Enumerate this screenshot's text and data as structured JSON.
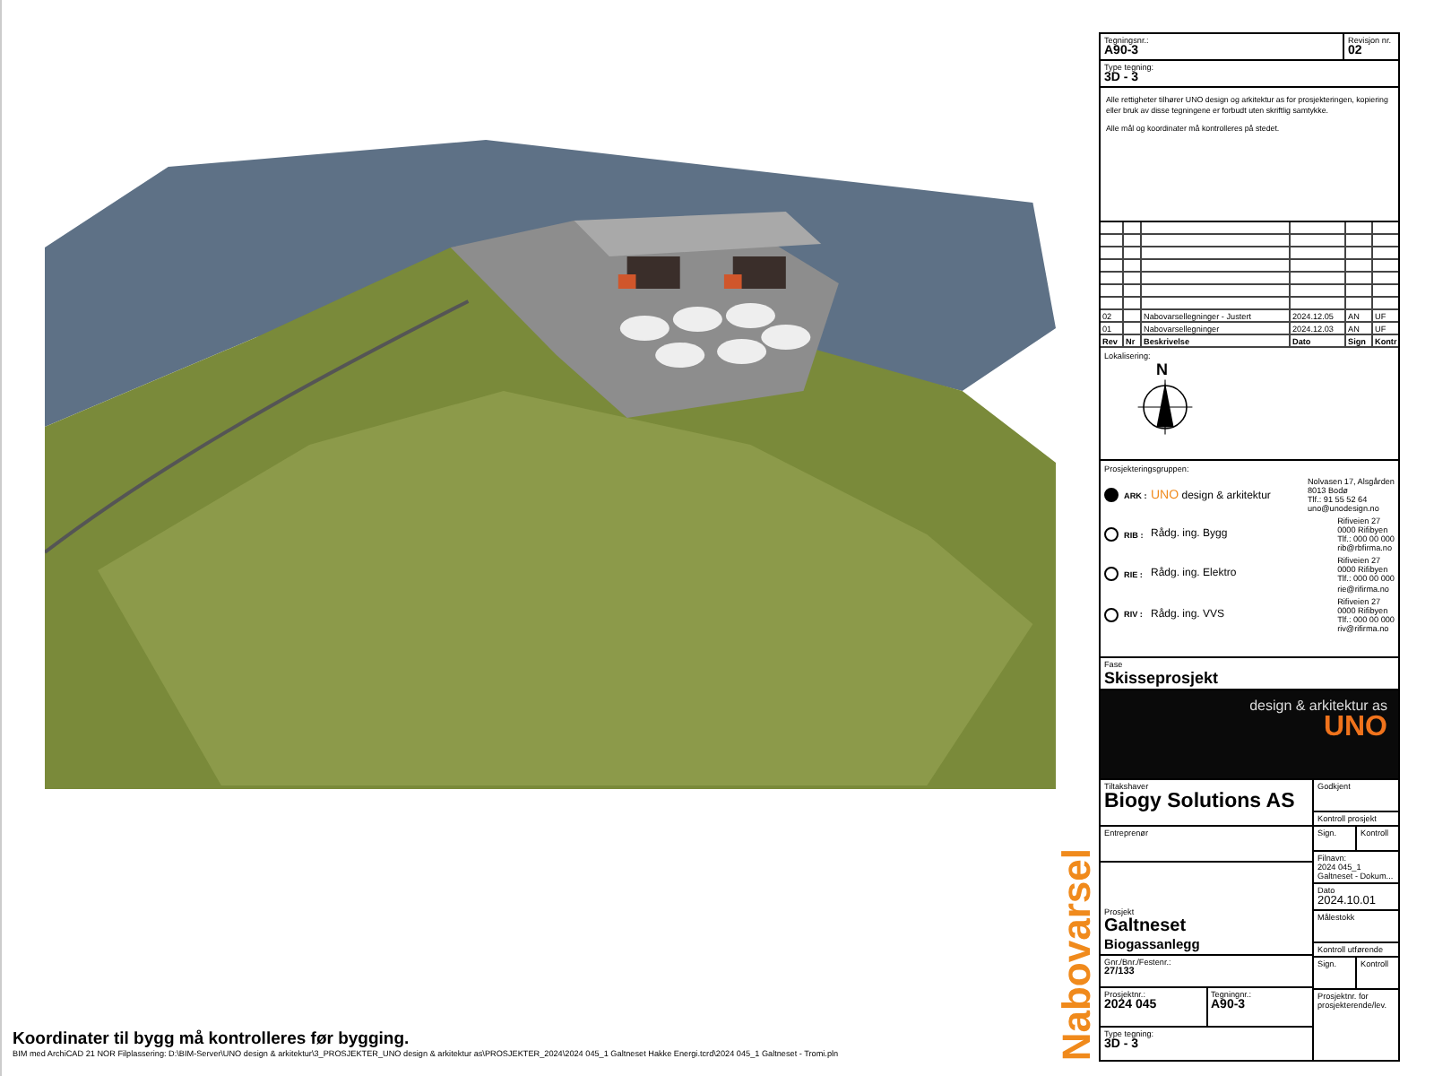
{
  "drawing": {
    "note": "Koordinater til bygg må kontrolleres før bygging.",
    "file_path": "BIM med ArchiCAD 21 NOR    Filplassering: D:\\BIM-Server\\UNO design & arkitektur\\3_PROSJEKTER_UNO design & arkitektur as\\PROSJEKTER_2024\\2024 045_1 Galtneset Hakke Energi.tcrd\\2024 045_1 Galtneset - Tromi.pln",
    "stamp": "Nabovarsel"
  },
  "title_block": {
    "top": [
      {
        "label": "Tegningsnr.:",
        "value": "A90-3"
      },
      {
        "label": "Revisjon nr.",
        "value": "02"
      }
    ],
    "type": {
      "label": "Type tegning:",
      "value": "3D - 3"
    },
    "notes": [
      "Alle rettigheter tilhører UNO design og arkitektur as for prosjekteringen, kopiering eller bruk av disse tegningene er forbudt uten skriftlig samtykke.",
      "Alle mål og koordinater må kontrolleres på stedet."
    ],
    "revisions": {
      "rows": [
        {
          "rev": "02",
          "description": "Nabovarsellegninger - Justert",
          "date": "2024.12.05",
          "sign": "AN",
          "control": "UF"
        },
        {
          "rev": "01",
          "description": "Nabovarsellegninger",
          "date": "2024.12.03",
          "sign": "AN",
          "control": "UF"
        }
      ],
      "columns": [
        "Rev",
        "Nr",
        "Beskrivelse",
        "Dato",
        "Sign",
        "Kontr"
      ]
    },
    "location": {
      "label": "Lokalisering:",
      "north": "N"
    },
    "team": {
      "label": "Prosjekteringsgruppen:",
      "members": [
        {
          "role": "ARK :",
          "brand": "UNO",
          "name": " design & arkitektur",
          "selected": true,
          "address": [
            "Nolvasen 17, Alsgården",
            "8013 Bodø",
            "Tlf.: 91 55 52 64",
            "uno@unodesign.no"
          ]
        },
        {
          "role": "RIB :",
          "name": "Rådg. ing. Bygg",
          "selected": false,
          "address": [
            "Rifiveien 27",
            "0000 Rifibyen",
            "Tlf.: 000 00 000",
            "rib@rbfirma.no"
          ]
        },
        {
          "role": "RIE :",
          "name": "Rådg. ing. Elektro",
          "selected": false,
          "address": [
            "Rifiveien 27",
            "0000 Rifibyen",
            "Tlf.: 000 00 000",
            "rie@rifirma.no"
          ]
        },
        {
          "role": "RIV :",
          "name": "Rådg. ing. VVS",
          "selected": false,
          "address": [
            "Rifiveien 27",
            "0000 Rifibyen",
            "Tlf.: 000 00 000",
            "riv@rifirma.no"
          ]
        }
      ]
    },
    "phase": {
      "label": "Fase",
      "value": "Skisseprosjekt"
    },
    "logo": {
      "tagline": "design & arkitektur as",
      "name": "UNO"
    },
    "client": {
      "label": "Tiltakshaver",
      "value": "Biogy Solutions AS"
    },
    "contractor": {
      "label": "Entreprenør"
    },
    "project": {
      "label": "Prosjekt",
      "name": "Galtneset",
      "subtitle": "Biogassanlegg"
    },
    "property": {
      "label": "Gnr./Bnr./Festenr.:",
      "value": "27/133"
    },
    "project_no": {
      "label": "Prosjektnr.:",
      "value": "2024 045"
    },
    "drawing_no": {
      "label": "Tegningnr.:",
      "value": "A90-3"
    },
    "drawing_type": {
      "label": "Type tegning:",
      "value": "3D - 3"
    },
    "approved": {
      "label": "Godkjent"
    },
    "check_project": {
      "label": "Kontroll prosjekt",
      "sign": "Sign.",
      "control": "Kontroll"
    },
    "file_name": {
      "label": "Filnavn:",
      "value": "2024 045_1 Galtneset - Dokum..."
    },
    "date": {
      "label": "Dato",
      "value": "2024.10.01"
    },
    "scale": {
      "label": "Målestokk"
    },
    "check_exec": {
      "label": "Kontroll utførende",
      "sign": "Sign.",
      "control": "Kontroll"
    },
    "designer_no": {
      "label": "Prosjektnr. for prosjekterende/lev."
    }
  }
}
